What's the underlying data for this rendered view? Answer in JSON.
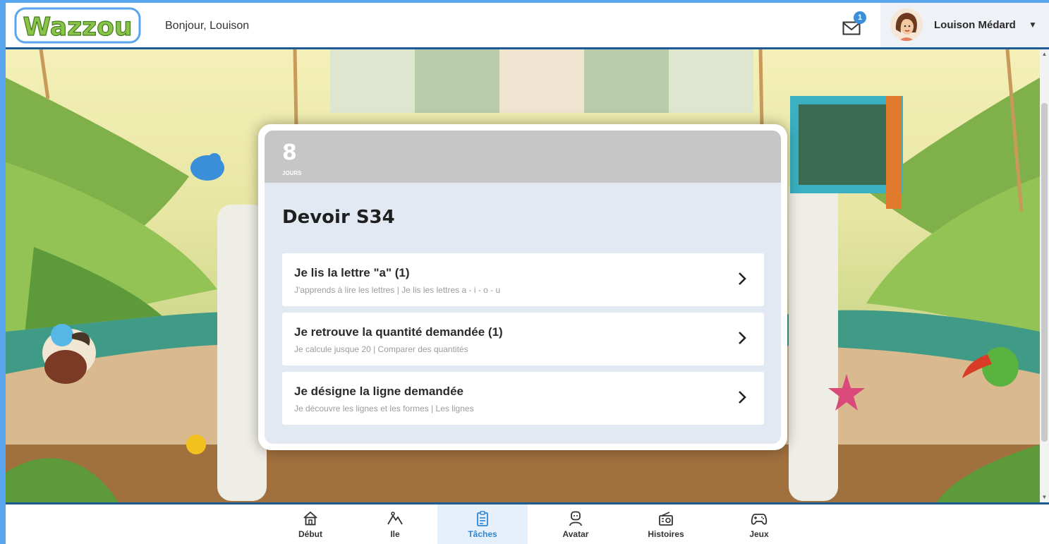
{
  "header": {
    "logo_text": "Wazzou",
    "greeting": "Bonjour, Louison",
    "mail_count": "1",
    "user_name": "Louison Médard",
    "caret": "▼"
  },
  "assignment": {
    "days_value": "8",
    "days_label": "JOURS",
    "title": "Devoir S34",
    "tasks": [
      {
        "title": "Je lis la lettre \"a\" (1)",
        "subtitle": "J'apprends à lire les lettres  |  Je lis les lettres a - i - o - u"
      },
      {
        "title": "Je retrouve la quantité demandée (1)",
        "subtitle": "Je calcule jusque 20  |  Comparer des quantités"
      },
      {
        "title": "Je désigne la ligne demandée",
        "subtitle": "Je découvre les lignes et les formes  |  Les lignes"
      }
    ]
  },
  "nav": {
    "items": [
      {
        "label": "Début",
        "icon": "home-icon"
      },
      {
        "label": "Ile",
        "icon": "mountain-icon"
      },
      {
        "label": "Tâches",
        "icon": "clipboard-icon",
        "active": true
      },
      {
        "label": "Avatar",
        "icon": "avatar-icon"
      },
      {
        "label": "Histoires",
        "icon": "radio-icon"
      },
      {
        "label": "Jeux",
        "icon": "gamepad-icon"
      }
    ]
  },
  "colors": {
    "frame": "#5aa6ee",
    "header_border": "#1d5b96",
    "accent": "#2f86d4",
    "logo_green": "#8bc34a"
  }
}
